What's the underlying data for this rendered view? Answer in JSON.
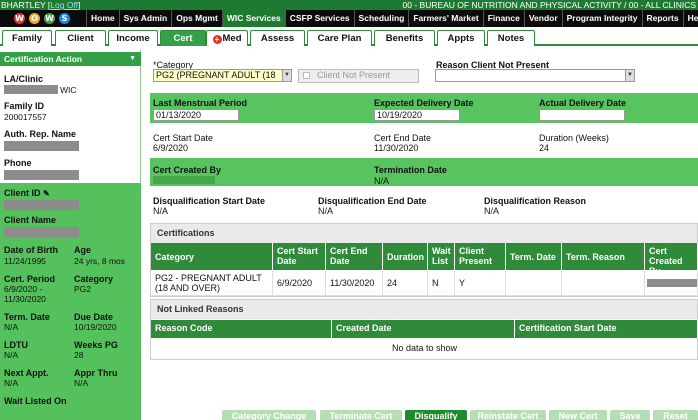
{
  "titlebar": {
    "user": "BHARTLEY [",
    "logoff": "Log Off",
    "user_close": "]",
    "agency": "00 - BUREAU OF NUTRITION AND PHYSICAL ACTIVITY / 00 - ALL CLINICS"
  },
  "logo": {
    "letters": [
      "W",
      "O",
      "W",
      "S"
    ],
    "colors": [
      "#e53935",
      "#f9a825",
      "#43a047",
      "#1e88e5"
    ]
  },
  "nav": {
    "items": [
      "Home",
      "Sys Admin",
      "Ops Mgmt",
      "WIC Services",
      "CSFP Services",
      "Scheduling",
      "Farmers' Market",
      "Finance",
      "Vendor",
      "Program Integrity",
      "Reports",
      "Help"
    ],
    "active": "WIC Services"
  },
  "tabs": {
    "items": [
      "Family",
      "Client",
      "Income",
      "Cert",
      "Med",
      "Assess",
      "Care Plan",
      "Benefits",
      "Appts",
      "Notes"
    ],
    "active": "Cert"
  },
  "sidebar": {
    "action_dropdown": "Certification Action",
    "la_clinic_label": "LA/Clinic",
    "la_clinic_value": "WIC",
    "family_id_label": "Family ID",
    "family_id_value": "200017557",
    "auth_rep_label": "Auth. Rep. Name",
    "phone_label": "Phone",
    "client_id_label": "Client ID",
    "client_name_label": "Client Name",
    "dob_label": "Date of Birth",
    "dob_value": "11/24/1995",
    "age_label": "Age",
    "age_value": "24 yrs, 8 mos",
    "cert_period_label": "Cert. Period",
    "cert_period_value": "6/9/2020 -\n11/30/2020",
    "category_label": "Category",
    "category_value": "PG2",
    "term_date_label": "Term. Date",
    "term_date_value": "N/A",
    "due_date_label": "Due Date",
    "due_date_value": "10/19/2020",
    "ldtu_label": "LDTU",
    "ldtu_value": "N/A",
    "weeks_pg_label": "Weeks PG",
    "weeks_pg_value": "28",
    "next_appt_label": "Next Appt.",
    "next_appt_value": "N/A",
    "appr_thru_label": "Appr Thru",
    "appr_thru_value": "N/A",
    "wait_listed_label": "Wait Listed On"
  },
  "form": {
    "category_label": "*Category",
    "category_value": "PG2 (PREGNANT ADULT (18",
    "client_not_present_label": "Client Not Present",
    "reason_label": "Reason Client Not Present",
    "reason_value": "",
    "lmp_label": "Last Menstrual Period",
    "lmp_value": "01/13/2020",
    "edd_label": "Expected Delivery Date",
    "edd_value": "10/19/2020",
    "add_label": "Actual Delivery Date",
    "add_value": "",
    "cert_start_label": "Cert Start Date",
    "cert_start_value": "6/9/2020",
    "cert_end_label": "Cert End Date",
    "cert_end_value": "11/30/2020",
    "duration_label": "Duration (Weeks)",
    "duration_value": "24",
    "created_by_label": "Cert Created By",
    "termination_label": "Termination Date",
    "termination_value": "N/A",
    "disq_start_label": "Disqualification Start Date",
    "disq_start_value": "N/A",
    "disq_end_label": "Disqualification End Date",
    "disq_end_value": "N/A",
    "disq_reason_label": "Disqualification Reason",
    "disq_reason_value": "N/A"
  },
  "certifications": {
    "title": "Certifications",
    "columns": [
      "Category",
      "Cert Start Date",
      "Cert End Date",
      "Duration",
      "Wait List",
      "Client Present",
      "Term. Date",
      "Term. Reason",
      "Cert Created By"
    ],
    "rows": [
      [
        "PG2 - PREGNANT ADULT (18 AND OVER)",
        "6/9/2020",
        "11/30/2020",
        "24",
        "N",
        "Y",
        "",
        "",
        ""
      ]
    ]
  },
  "not_linked": {
    "title": "Not Linked Reasons",
    "columns": [
      "Reason Code",
      "Created Date",
      "Certification Start Date"
    ],
    "empty_text": "No data to show"
  },
  "buttons": [
    "Category Change",
    "Terminate Cert",
    "Disqualify",
    "Reinstate Cert",
    "New Cert",
    "Save",
    "Reset"
  ],
  "colors": {
    "brand_green": "#2f8a3a",
    "band_green": "#57c45f",
    "nav_black": "#0b0b0b"
  }
}
